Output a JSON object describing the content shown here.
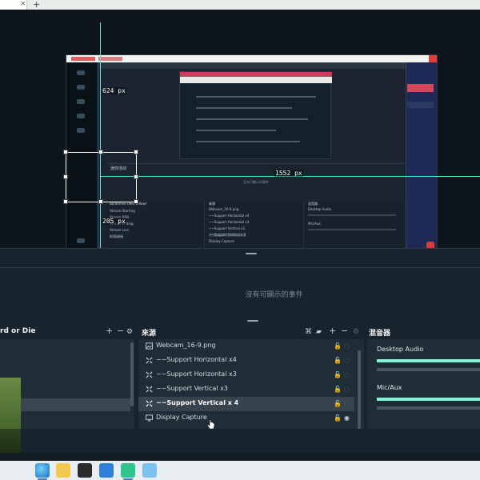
{
  "topbar": {
    "tab_close": "×",
    "new_tab": "+"
  },
  "preview": {
    "measure_top": "624 px",
    "measure_right": "1552 px",
    "measure_bottom": "205 px",
    "inner_events_label": "迷你活动",
    "inner_events_empty": "没有可顯示的事件",
    "inner_scenes_header": "Borderline (Red Yellow)",
    "inner_scenes": [
      "Stream Starting",
      "Stream BRB",
      "Stream Ending",
      "Stream Live",
      "In-Game"
    ],
    "inner_sources_header": "来源",
    "inner_sources": [
      "Webcam_16-9.png",
      "~~Support Horizontal x4",
      "~~Support Horizontal x3",
      "~~Support Vertical x3",
      "~~Support Vertical x 4",
      "Display Capture"
    ],
    "inner_mixer_header": "混音器",
    "inner_mixer": [
      "Desktop Audio",
      "Mic/Aux"
    ]
  },
  "events": {
    "empty_text": "沒有可顯示的事件"
  },
  "scenes": {
    "title": "rd or Die"
  },
  "sources": {
    "title": "來源",
    "items": [
      {
        "label": "Webcam_16-9.png",
        "icon": "image-icon"
      },
      {
        "label": "~~Support Horizontal x4",
        "icon": "transform-icon"
      },
      {
        "label": "~~Support Horizontal x3",
        "icon": "transform-icon"
      },
      {
        "label": "~~Support Vertical x3",
        "icon": "transform-icon"
      },
      {
        "label": "~~Support Vertical x 4",
        "icon": "transform-icon"
      },
      {
        "label": "Display Capture",
        "icon": "monitor-icon"
      }
    ],
    "selected_index": 4
  },
  "mixer": {
    "title": "混音器",
    "channels": [
      {
        "label": "Desktop Audio",
        "level": 0.0
      },
      {
        "label": "Mic/Aux",
        "level": 0.0
      }
    ]
  },
  "colors": {
    "accent": "#80f5d2",
    "guide": "#5fe3c8",
    "record": "#d93b3b"
  }
}
